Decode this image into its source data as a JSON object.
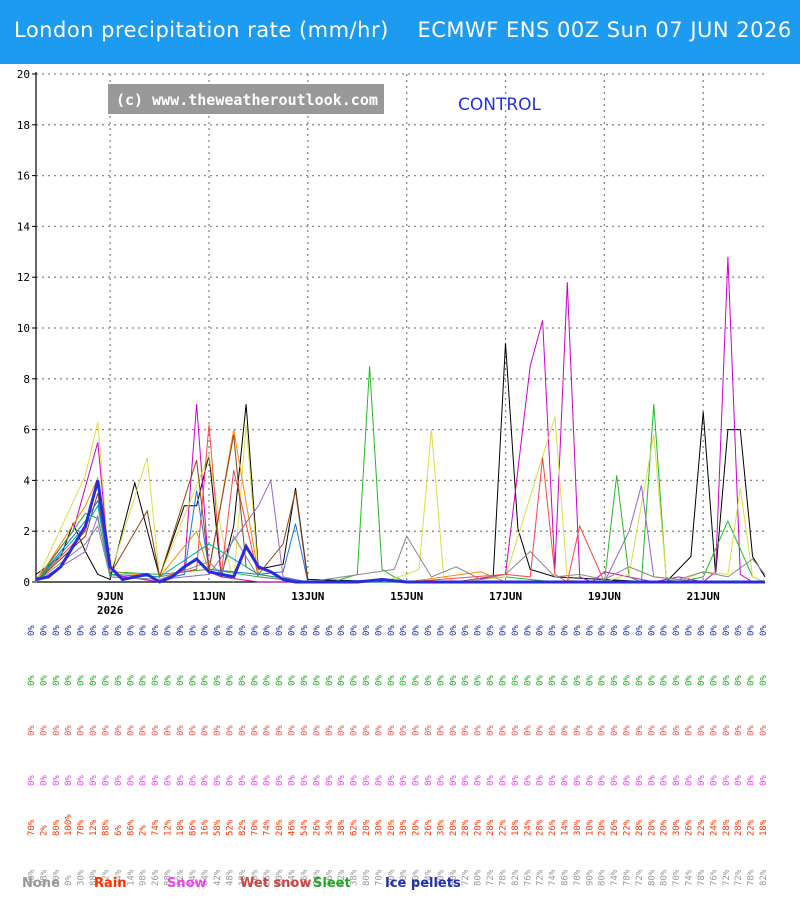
{
  "header": {
    "title": "London precipitation rate (mm/hr)    ECMWF ENS 00Z Sun 07 JUN 2026"
  },
  "chart_data": {
    "type": "line",
    "copyright": "(c) www.theweatheroutlook.com",
    "control_label": "CONTROL",
    "ylim": [
      0,
      20
    ],
    "yticks": [
      "0",
      "2",
      "4",
      "6",
      "8",
      "10",
      "12",
      "14",
      "16",
      "18",
      "20"
    ],
    "x_days": [
      7.5,
      22.25
    ],
    "xticks": [
      {
        "day": 9,
        "label": "9JUN",
        "sub": "2026"
      },
      {
        "day": 11,
        "label": "11JUN",
        "sub": ""
      },
      {
        "day": 13,
        "label": "13JUN",
        "sub": ""
      },
      {
        "day": 15,
        "label": "15JUN",
        "sub": ""
      },
      {
        "day": 17,
        "label": "17JUN",
        "sub": ""
      },
      {
        "day": 19,
        "label": "19JUN",
        "sub": ""
      },
      {
        "day": 21,
        "label": "21JUN",
        "sub": ""
      }
    ],
    "grid": true,
    "control": {
      "day": [
        7.5,
        7.75,
        8.0,
        8.25,
        8.5,
        8.75,
        9.0,
        9.25,
        9.5,
        9.75,
        10.0,
        10.25,
        10.5,
        10.75,
        11.0,
        11.25,
        11.5,
        11.75,
        12.0,
        12.25,
        12.5,
        12.75,
        13.0,
        13.5,
        14.0,
        14.5,
        15.0,
        16.0,
        17.0,
        18.0,
        19.0,
        20.0,
        21.0,
        22.0,
        22.25
      ],
      "value": [
        0.1,
        0.2,
        0.6,
        1.4,
        2.2,
        4.0,
        0.6,
        0.1,
        0.2,
        0.3,
        0.0,
        0.2,
        0.6,
        0.9,
        0.4,
        0.3,
        0.2,
        1.4,
        0.6,
        0.4,
        0.1,
        0.0,
        0.0,
        0.0,
        0.0,
        0.1,
        0.0,
        0.0,
        0.0,
        0.0,
        0.0,
        0.0,
        0.0,
        0.0,
        0.0
      ]
    },
    "series": [
      {
        "color": "#000000",
        "day": [
          7.5,
          8.0,
          8.25,
          8.5,
          8.75,
          9.0,
          9.5,
          10.0,
          10.5,
          10.75,
          11.0,
          11.25,
          11.5,
          11.75,
          12.0,
          12.5,
          12.75,
          13.0,
          15.0,
          16.0,
          16.75,
          17.0,
          17.25,
          17.5,
          18.0,
          19.0,
          20.0,
          20.25,
          20.75,
          21.0,
          21.25,
          21.5,
          21.75,
          22.0,
          22.25
        ],
        "value": [
          0.3,
          1.0,
          2.3,
          1.2,
          0.3,
          0.1,
          3.9,
          0.2,
          3.0,
          3.0,
          5.0,
          0.2,
          2.2,
          7.0,
          0.5,
          0.7,
          3.7,
          0.1,
          0.0,
          0.0,
          0.2,
          9.4,
          2.1,
          0.5,
          0.2,
          0.1,
          0.0,
          0.0,
          1.0,
          6.7,
          0.3,
          6.0,
          6.0,
          1.0,
          0.2
        ]
      },
      {
        "color": "#cc00cc",
        "day": [
          7.5,
          8.25,
          8.75,
          9.0,
          10.0,
          10.5,
          10.75,
          11.0,
          11.25,
          12.0,
          12.5,
          13.0,
          15.0,
          16.0,
          17.0,
          17.5,
          17.75,
          18.0,
          18.25,
          18.5,
          18.75,
          19.0,
          20.0,
          20.5,
          21.0,
          21.25,
          21.5,
          21.75,
          22.0,
          22.25
        ],
        "value": [
          0.1,
          2.0,
          5.5,
          0.3,
          0.0,
          0.5,
          7.0,
          0.4,
          0.2,
          0.0,
          0.0,
          0.0,
          0.0,
          0.0,
          0.3,
          8.5,
          10.3,
          0.5,
          11.8,
          0.2,
          0.0,
          0.4,
          0.0,
          0.2,
          0.0,
          0.4,
          12.8,
          0.3,
          0.0,
          0.0
        ]
      },
      {
        "color": "#22bb22",
        "day": [
          7.5,
          8.5,
          8.75,
          9.0,
          10.0,
          11.0,
          12.0,
          13.0,
          13.5,
          14.0,
          14.25,
          14.5,
          14.75,
          15.0,
          16.0,
          17.0,
          18.0,
          18.5,
          19.0,
          19.25,
          19.5,
          19.75,
          20.0,
          20.25,
          20.5,
          21.0,
          21.5,
          22.0,
          22.25
        ],
        "value": [
          0.0,
          2.7,
          2.5,
          0.4,
          0.3,
          0.5,
          0.2,
          0.0,
          0.0,
          0.3,
          8.5,
          0.5,
          0.2,
          0.0,
          0.0,
          0.2,
          0.0,
          0.0,
          0.0,
          4.2,
          0.2,
          0.0,
          7.0,
          0.1,
          0.0,
          0.2,
          2.4,
          0.2,
          0.0
        ]
      },
      {
        "color": "#dddd44",
        "day": [
          7.5,
          8.5,
          8.75,
          9.0,
          9.75,
          10.0,
          11.0,
          11.25,
          11.5,
          11.75,
          12.0,
          13.0,
          14.5,
          15.0,
          15.25,
          15.5,
          15.75,
          16.0,
          17.0,
          18.0,
          18.25,
          18.5,
          19.0,
          19.5,
          20.0,
          20.25,
          20.5,
          21.0,
          21.5,
          21.75,
          22.0,
          22.25
        ],
        "value": [
          0.0,
          4.2,
          6.3,
          0.3,
          4.9,
          0.2,
          5.0,
          2.0,
          0.0,
          6.2,
          0.3,
          0.0,
          0.0,
          0.3,
          0.5,
          6.0,
          0.2,
          0.0,
          0.2,
          6.5,
          0.1,
          0.0,
          0.0,
          0.3,
          5.8,
          0.2,
          0.0,
          0.4,
          0.3,
          3.7,
          0.2,
          0.0
        ]
      },
      {
        "color": "#ff4444",
        "day": [
          7.5,
          8.5,
          8.75,
          9.0,
          10.0,
          10.75,
          11.0,
          11.25,
          11.5,
          12.0,
          13.0,
          15.0,
          17.0,
          17.5,
          17.75,
          18.0,
          18.25,
          18.5,
          19.0,
          22.25
        ],
        "value": [
          0.0,
          2.0,
          4.0,
          0.3,
          0.2,
          0.5,
          6.2,
          0.3,
          4.4,
          0.2,
          0.0,
          0.0,
          0.3,
          0.2,
          4.9,
          0.3,
          0.0,
          2.2,
          0.0,
          0.0
        ]
      },
      {
        "color": "#1a73e8",
        "day": [
          7.5,
          8.5,
          8.75,
          9.0,
          10.0,
          10.5,
          10.75,
          11.0,
          12.0,
          12.5,
          12.75,
          13.0,
          15.0,
          17.0,
          19.0,
          21.0,
          22.25
        ],
        "value": [
          0.0,
          2.4,
          3.2,
          0.2,
          0.1,
          0.3,
          3.6,
          0.5,
          0.3,
          0.4,
          2.3,
          0.0,
          0.0,
          0.0,
          0.0,
          0.0,
          0.0
        ]
      },
      {
        "color": "#ff8800",
        "day": [
          7.5,
          8.5,
          8.75,
          9.0,
          10.0,
          10.75,
          11.0,
          11.5,
          12.0,
          13.0,
          15.0,
          16.5,
          17.0,
          19.0,
          21.0,
          22.25
        ],
        "value": [
          0.0,
          3.0,
          4.1,
          0.4,
          0.2,
          2.0,
          0.4,
          6.0,
          0.3,
          0.0,
          0.0,
          0.4,
          0.0,
          0.0,
          0.0,
          0.0
        ]
      },
      {
        "color": "#8B4513",
        "day": [
          7.5,
          8.5,
          8.75,
          9.0,
          9.75,
          10.0,
          10.75,
          11.0,
          11.5,
          11.75,
          12.0,
          12.5,
          12.75,
          13.0,
          15.0,
          17.0,
          19.0,
          21.0,
          22.25
        ],
        "value": [
          0.0,
          1.8,
          3.5,
          0.3,
          2.8,
          0.2,
          4.8,
          0.5,
          5.8,
          0.6,
          0.3,
          1.5,
          3.6,
          0.0,
          0.0,
          0.0,
          0.0,
          0.0,
          0.0
        ]
      },
      {
        "color": "#9966cc",
        "day": [
          7.5,
          8.5,
          8.75,
          9.0,
          10.0,
          11.0,
          12.0,
          12.25,
          12.5,
          13.0,
          15.0,
          17.0,
          19.0,
          19.5,
          19.75,
          20.0,
          21.0,
          22.25
        ],
        "value": [
          0.0,
          1.2,
          2.6,
          0.2,
          0.1,
          0.3,
          3.0,
          4.0,
          0.2,
          0.0,
          0.0,
          0.0,
          0.0,
          2.0,
          3.8,
          0.2,
          0.0,
          0.0
        ]
      },
      {
        "color": "#00aaaa",
        "day": [
          7.5,
          8.5,
          8.75,
          9.0,
          10.0,
          11.0,
          12.0,
          13.0,
          15.0,
          17.0,
          19.0,
          21.0,
          22.25
        ],
        "value": [
          0.0,
          2.2,
          3.0,
          0.3,
          0.2,
          1.5,
          0.3,
          0.0,
          0.0,
          0.0,
          0.0,
          0.0,
          0.0
        ]
      },
      {
        "color": "#888888",
        "day": [
          7.5,
          8.5,
          8.75,
          9.0,
          10.0,
          11.0,
          11.25,
          11.5,
          12.0,
          13.0,
          14.75,
          15.0,
          15.5,
          16.0,
          16.5,
          17.0,
          17.5,
          18.0,
          18.5,
          19.0,
          19.5,
          20.0,
          20.5,
          21.0,
          21.5,
          22.0,
          22.25
        ],
        "value": [
          0.0,
          1.5,
          2.2,
          0.2,
          0.1,
          0.8,
          0.3,
          1.8,
          0.2,
          0.0,
          0.5,
          1.8,
          0.2,
          0.6,
          0.1,
          0.3,
          1.2,
          0.2,
          0.3,
          0.1,
          0.6,
          0.2,
          0.1,
          0.4,
          0.2,
          0.9,
          0.3
        ]
      }
    ],
    "percent_rows": [
      {
        "name": "ice-pellets",
        "color": "#2233aa",
        "values": [
          "0%",
          "0%",
          "0%",
          "0%",
          "0%",
          "0%",
          "0%",
          "0%",
          "0%",
          "0%",
          "0%",
          "0%",
          "0%",
          "0%",
          "0%",
          "0%",
          "0%",
          "0%",
          "0%",
          "0%",
          "0%",
          "0%",
          "0%",
          "0%",
          "0%",
          "0%",
          "0%",
          "0%",
          "0%",
          "0%",
          "0%",
          "0%",
          "0%",
          "0%",
          "0%",
          "0%",
          "0%",
          "0%",
          "0%",
          "0%",
          "0%",
          "0%",
          "0%",
          "0%",
          "0%",
          "0%",
          "0%",
          "0%",
          "0%",
          "0%",
          "0%",
          "0%",
          "0%",
          "0%",
          "0%",
          "0%",
          "0%",
          "0%",
          "0%",
          "0%"
        ]
      },
      {
        "name": "sleet",
        "color": "#22aa22",
        "values": [
          "0%",
          "0%",
          "0%",
          "0%",
          "0%",
          "0%",
          "0%",
          "0%",
          "0%",
          "0%",
          "0%",
          "0%",
          "0%",
          "0%",
          "0%",
          "0%",
          "0%",
          "0%",
          "0%",
          "0%",
          "0%",
          "0%",
          "0%",
          "0%",
          "0%",
          "0%",
          "0%",
          "0%",
          "0%",
          "0%",
          "0%",
          "0%",
          "0%",
          "0%",
          "0%",
          "0%",
          "0%",
          "0%",
          "0%",
          "0%",
          "0%",
          "0%",
          "0%",
          "0%",
          "0%",
          "0%",
          "0%",
          "0%",
          "0%",
          "0%",
          "0%",
          "0%",
          "0%",
          "0%",
          "0%",
          "0%",
          "0%",
          "0%",
          "0%",
          "0%"
        ]
      },
      {
        "name": "wet-snow",
        "color": "#ee5555",
        "values": [
          "0%",
          "0%",
          "0%",
          "0%",
          "0%",
          "0%",
          "0%",
          "0%",
          "0%",
          "0%",
          "0%",
          "0%",
          "0%",
          "0%",
          "0%",
          "0%",
          "0%",
          "0%",
          "0%",
          "0%",
          "0%",
          "0%",
          "0%",
          "0%",
          "0%",
          "0%",
          "0%",
          "0%",
          "0%",
          "0%",
          "0%",
          "0%",
          "0%",
          "0%",
          "0%",
          "0%",
          "0%",
          "0%",
          "0%",
          "0%",
          "0%",
          "0%",
          "0%",
          "0%",
          "0%",
          "0%",
          "0%",
          "0%",
          "0%",
          "0%",
          "0%",
          "0%",
          "0%",
          "0%",
          "0%",
          "0%",
          "0%",
          "0%",
          "0%",
          "0%"
        ]
      },
      {
        "name": "snow",
        "color": "#ee44ee",
        "values": [
          "0%",
          "0%",
          "0%",
          "0%",
          "0%",
          "0%",
          "0%",
          "0%",
          "0%",
          "0%",
          "0%",
          "0%",
          "0%",
          "0%",
          "0%",
          "0%",
          "0%",
          "0%",
          "0%",
          "0%",
          "0%",
          "0%",
          "0%",
          "0%",
          "0%",
          "0%",
          "0%",
          "0%",
          "0%",
          "0%",
          "0%",
          "0%",
          "0%",
          "0%",
          "0%",
          "0%",
          "0%",
          "0%",
          "0%",
          "0%",
          "0%",
          "0%",
          "0%",
          "0%",
          "0%",
          "0%",
          "0%",
          "0%",
          "0%",
          "0%",
          "0%",
          "0%",
          "0%",
          "0%",
          "0%",
          "0%",
          "0%",
          "0%",
          "0%",
          "0%"
        ]
      },
      {
        "name": "rain",
        "color": "#ff3300",
        "values": [
          "70%",
          "2%",
          "80%",
          "100%",
          "70%",
          "12%",
          "88%",
          "6%",
          "86%",
          "2%",
          "74%",
          "12%",
          "18%",
          "86%",
          "16%",
          "58%",
          "52%",
          "82%",
          "70%",
          "74%",
          "20%",
          "46%",
          "54%",
          "26%",
          "34%",
          "38%",
          "62%",
          "20%",
          "30%",
          "20%",
          "30%",
          "20%",
          "26%",
          "30%",
          "20%",
          "28%",
          "20%",
          "28%",
          "22%",
          "18%",
          "24%",
          "28%",
          "26%",
          "14%",
          "30%",
          "10%",
          "20%",
          "26%",
          "22%",
          "28%",
          "20%",
          "20%",
          "30%",
          "26%",
          "22%",
          "24%",
          "28%",
          "28%",
          "22%",
          "18%"
        ]
      },
      {
        "name": "none",
        "color": "#999999",
        "values": [
          "30%",
          "98%",
          "20%",
          "0%",
          "30%",
          "88%",
          "12%",
          "94%",
          "14%",
          "98%",
          "26%",
          "88%",
          "82%",
          "14%",
          "84%",
          "42%",
          "48%",
          "18%",
          "30%",
          "26%",
          "80%",
          "54%",
          "46%",
          "74%",
          "66%",
          "62%",
          "38%",
          "80%",
          "70%",
          "80%",
          "70%",
          "80%",
          "74%",
          "70%",
          "80%",
          "72%",
          "80%",
          "72%",
          "78%",
          "82%",
          "76%",
          "72%",
          "74%",
          "86%",
          "70%",
          "90%",
          "80%",
          "74%",
          "78%",
          "72%",
          "80%",
          "80%",
          "70%",
          "74%",
          "78%",
          "76%",
          "72%",
          "72%",
          "78%",
          "82%"
        ]
      }
    ]
  },
  "legend": [
    {
      "label": "None",
      "color": "#999999"
    },
    {
      "label": "Rain",
      "color": "#ff3300"
    },
    {
      "label": "Snow",
      "color": "#ee44ee"
    },
    {
      "label": "Wet snow",
      "color": "#cc4444"
    },
    {
      "label": "Sleet",
      "color": "#22aa22"
    },
    {
      "label": "Ice pellets",
      "color": "#2233aa"
    }
  ]
}
